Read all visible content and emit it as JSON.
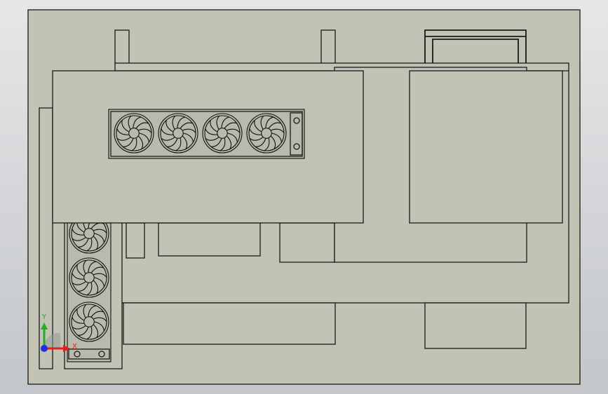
{
  "colors": {
    "background_top": "#e6e7e8",
    "background_bottom": "#c3c6ca",
    "part_face": "#c2c2b5",
    "edge": "#1a1a1a",
    "triad_x": "#e02020",
    "triad_y": "#20b020",
    "triad_z": "#2030e0"
  },
  "top_radiator": {
    "fan_count": 4
  },
  "side_radiator": {
    "fan_count": 3
  },
  "triad": {
    "x_label": "X",
    "y_label": "Y",
    "icon": "coordinate-triad-icon"
  }
}
